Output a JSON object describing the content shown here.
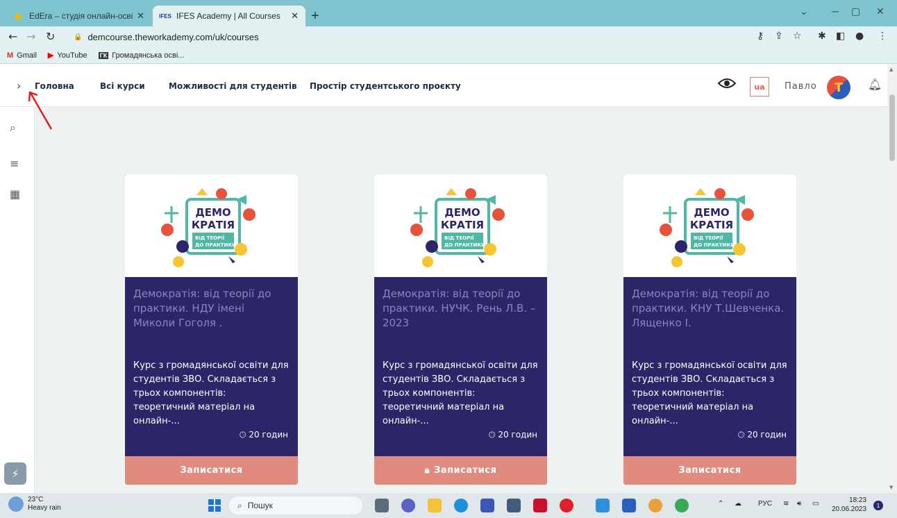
{
  "browser": {
    "tabs": [
      {
        "label": "EdEra – студія онлайн-освіти",
        "favicon": "edera-icon",
        "active": false
      },
      {
        "label": "IFES Academy | All Courses",
        "favicon": "ifes-icon",
        "active": true
      }
    ],
    "tab_close_glyph": "✕",
    "new_tab_glyph": "+",
    "url": "demcourse.theworkademy.com/uk/courses",
    "bookmarks": [
      {
        "label": "Gmail",
        "icon": "gmail-icon"
      },
      {
        "label": "YouTube",
        "icon": "youtube-icon"
      },
      {
        "label": "Громадянська осві...",
        "icon": "ifes-bookmark-icon"
      }
    ]
  },
  "site_nav": {
    "links": [
      "Головна",
      "Всі курси",
      "Можливості для студентів",
      "Простір студентського проєкту"
    ],
    "lang": "ua",
    "user_name": "Павло"
  },
  "courses": [
    {
      "title": "Демократія: від теорії до практики. НДУ імені Миколи Гоголя .",
      "description": "Курс з громадянської освіти для студентів ЗВО. Складається з трьох компонентів: теоретичний матеріал на онлайн-...",
      "hours": "20 годин",
      "enroll_label": "Записатися",
      "locked": false
    },
    {
      "title": "Демократія: від теорії до практики. НУЧК. Рень Л.В. – 2023",
      "description": "Курс з громадянської освіти для студентів ЗВО. Складається з трьох компонентів: теоретичний матеріал на онлайн-...",
      "hours": "20 годин",
      "enroll_label": "Записатися",
      "locked": true
    },
    {
      "title": "Демократія: від теорії до практики. КНУ Т.Шевченка. Лященко І.",
      "description": "Курс з громадянської освіти для студентів ЗВО. Складається з трьох компонентів: теоретичний матеріал на онлайн-...",
      "hours": "20 годин",
      "enroll_label": "Записатися",
      "locked": false
    }
  ],
  "course_logo": {
    "line1": "ДЕМО",
    "line2": "КРАТІЯ",
    "line3": "ВІД ТЕОРІЇ",
    "line4": "ДО ПРАКТИКИ"
  },
  "taskbar": {
    "temperature": "23°C",
    "weather": "Heavy rain",
    "search_placeholder": "Пошук",
    "lang_indicator": "РУС",
    "time": "18:23",
    "date": "20.06.2023",
    "notification_count": "1"
  },
  "colors": {
    "card_bg": "#2c2668",
    "enroll_bg": "#e08a80",
    "tab_strip": "#7fc4cf",
    "page_bg": "#eef3f2"
  }
}
